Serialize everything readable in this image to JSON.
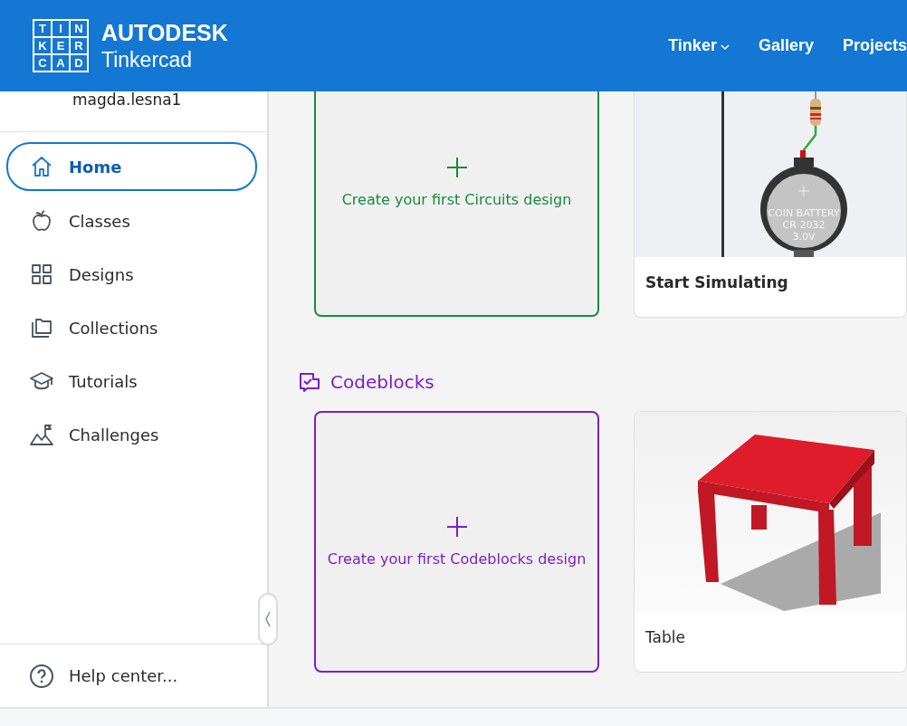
{
  "header": {
    "logo_letters": [
      "T",
      "I",
      "N",
      "K",
      "E",
      "R",
      "C",
      "A",
      "D"
    ],
    "brand": "AUTODESK",
    "product": "Tinkercad",
    "nav": [
      {
        "label": "Tinker",
        "dropdown": true
      },
      {
        "label": "Gallery",
        "dropdown": false
      },
      {
        "label": "Projects",
        "dropdown": false
      }
    ]
  },
  "sidebar": {
    "user": "magda.lesna1",
    "items": [
      {
        "label": "Home",
        "selected": true
      },
      {
        "label": "Classes",
        "selected": false
      },
      {
        "label": "Designs",
        "selected": false
      },
      {
        "label": "Collections",
        "selected": false
      },
      {
        "label": "Tutorials",
        "selected": false
      },
      {
        "label": "Challenges",
        "selected": false
      }
    ],
    "help": "Help center..."
  },
  "sections": [
    {
      "create": {
        "label": "Create your first Circuits design",
        "color": "#1a8a3c"
      },
      "sample": {
        "title": "Start Simulating",
        "battery_text": [
          "COIN BATTERY",
          "CR 2032",
          "3.0V"
        ]
      }
    },
    {
      "heading": "Codeblocks",
      "create": {
        "label": "Create your first Codeblocks design",
        "color": "#7b1fc8"
      },
      "sample": {
        "title": "Table"
      }
    }
  ]
}
